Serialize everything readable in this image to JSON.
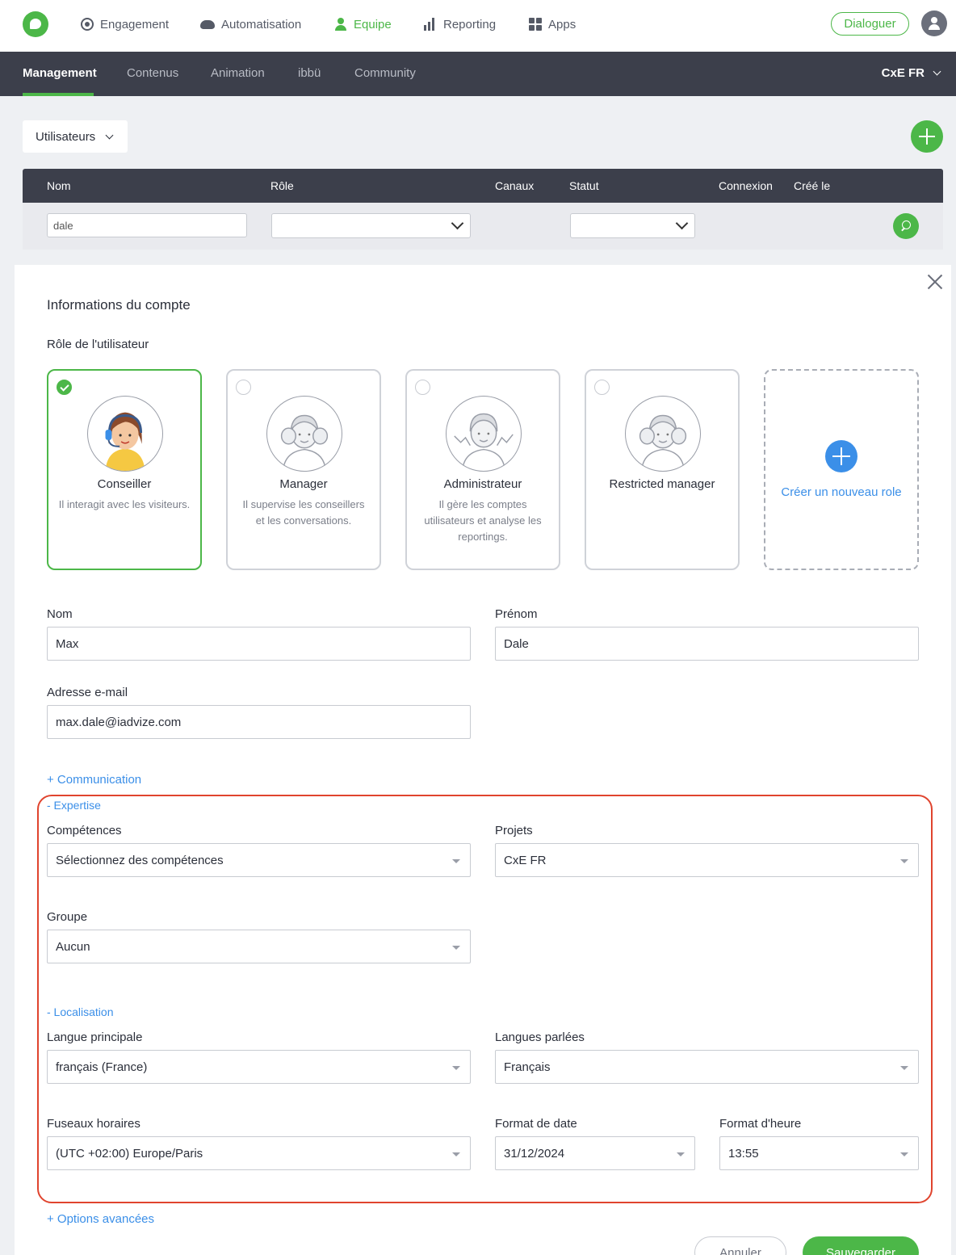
{
  "topnav": {
    "items": [
      {
        "label": "Engagement",
        "icon": "target-icon"
      },
      {
        "label": "Automatisation",
        "icon": "cloud-icon"
      },
      {
        "label": "Equipe",
        "icon": "person-icon",
        "active": true
      },
      {
        "label": "Reporting",
        "icon": "bar-chart-icon"
      },
      {
        "label": "Apps",
        "icon": "apps-grid-icon"
      }
    ],
    "dialoguer_label": "Dialoguer"
  },
  "subnav": {
    "items": [
      "Management",
      "Contenus",
      "Animation",
      "ibbü",
      "Community"
    ],
    "active": "Management",
    "project": "CxE FR"
  },
  "list": {
    "dropdown_label": "Utilisateurs",
    "columns": [
      "Nom",
      "Rôle",
      "Canaux",
      "Statut",
      "Connexion",
      "Créé le"
    ],
    "filter_name_value": "dale"
  },
  "panel": {
    "title": "Informations du compte",
    "role_section_label": "Rôle de l'utilisateur",
    "roles": [
      {
        "name": "Conseiller",
        "description": "Il interagit avec les visiteurs.",
        "selected": true
      },
      {
        "name": "Manager",
        "description": "Il supervise les conseillers et les conversations.",
        "selected": false
      },
      {
        "name": "Administrateur",
        "description": "Il gère les comptes utilisateurs et analyse les reportings.",
        "selected": false
      },
      {
        "name": "Restricted manager",
        "description": "",
        "selected": false
      }
    ],
    "new_role_label": "Créer un nouveau role",
    "fields": {
      "nom_label": "Nom",
      "nom_value": "Max",
      "prenom_label": "Prénom",
      "prenom_value": "Dale",
      "email_label": "Adresse e-mail",
      "email_value": "max.dale@iadvize.com"
    },
    "communication_link": "+ Communication",
    "expertise_link": "- Expertise",
    "competences_label": "Compétences",
    "competences_placeholder": "Sélectionnez des compétences",
    "projets_label": "Projets",
    "projets_value": "CxE FR",
    "groupe_label": "Groupe",
    "groupe_value": "Aucun",
    "localisation_link": "- Localisation",
    "langue_principale_label": "Langue principale",
    "langue_principale_value": "français (France)",
    "langues_parlees_label": "Langues parlées",
    "langues_parlees_value": "Français",
    "fuseaux_label": "Fuseaux horaires",
    "fuseaux_value": "(UTC +02:00) Europe/Paris",
    "format_date_label": "Format de date",
    "format_date_value": "31/12/2024",
    "format_heure_label": "Format d'heure",
    "format_heure_value": "13:55",
    "options_link": "+ Options avancées",
    "cancel_label": "Annuler",
    "save_label": "Sauvegarder"
  },
  "colors": {
    "brand_green": "#4cb748",
    "nav_dark": "#3c3f4b",
    "link_blue": "#3b8fe8",
    "highlight_red": "#e0442e"
  }
}
